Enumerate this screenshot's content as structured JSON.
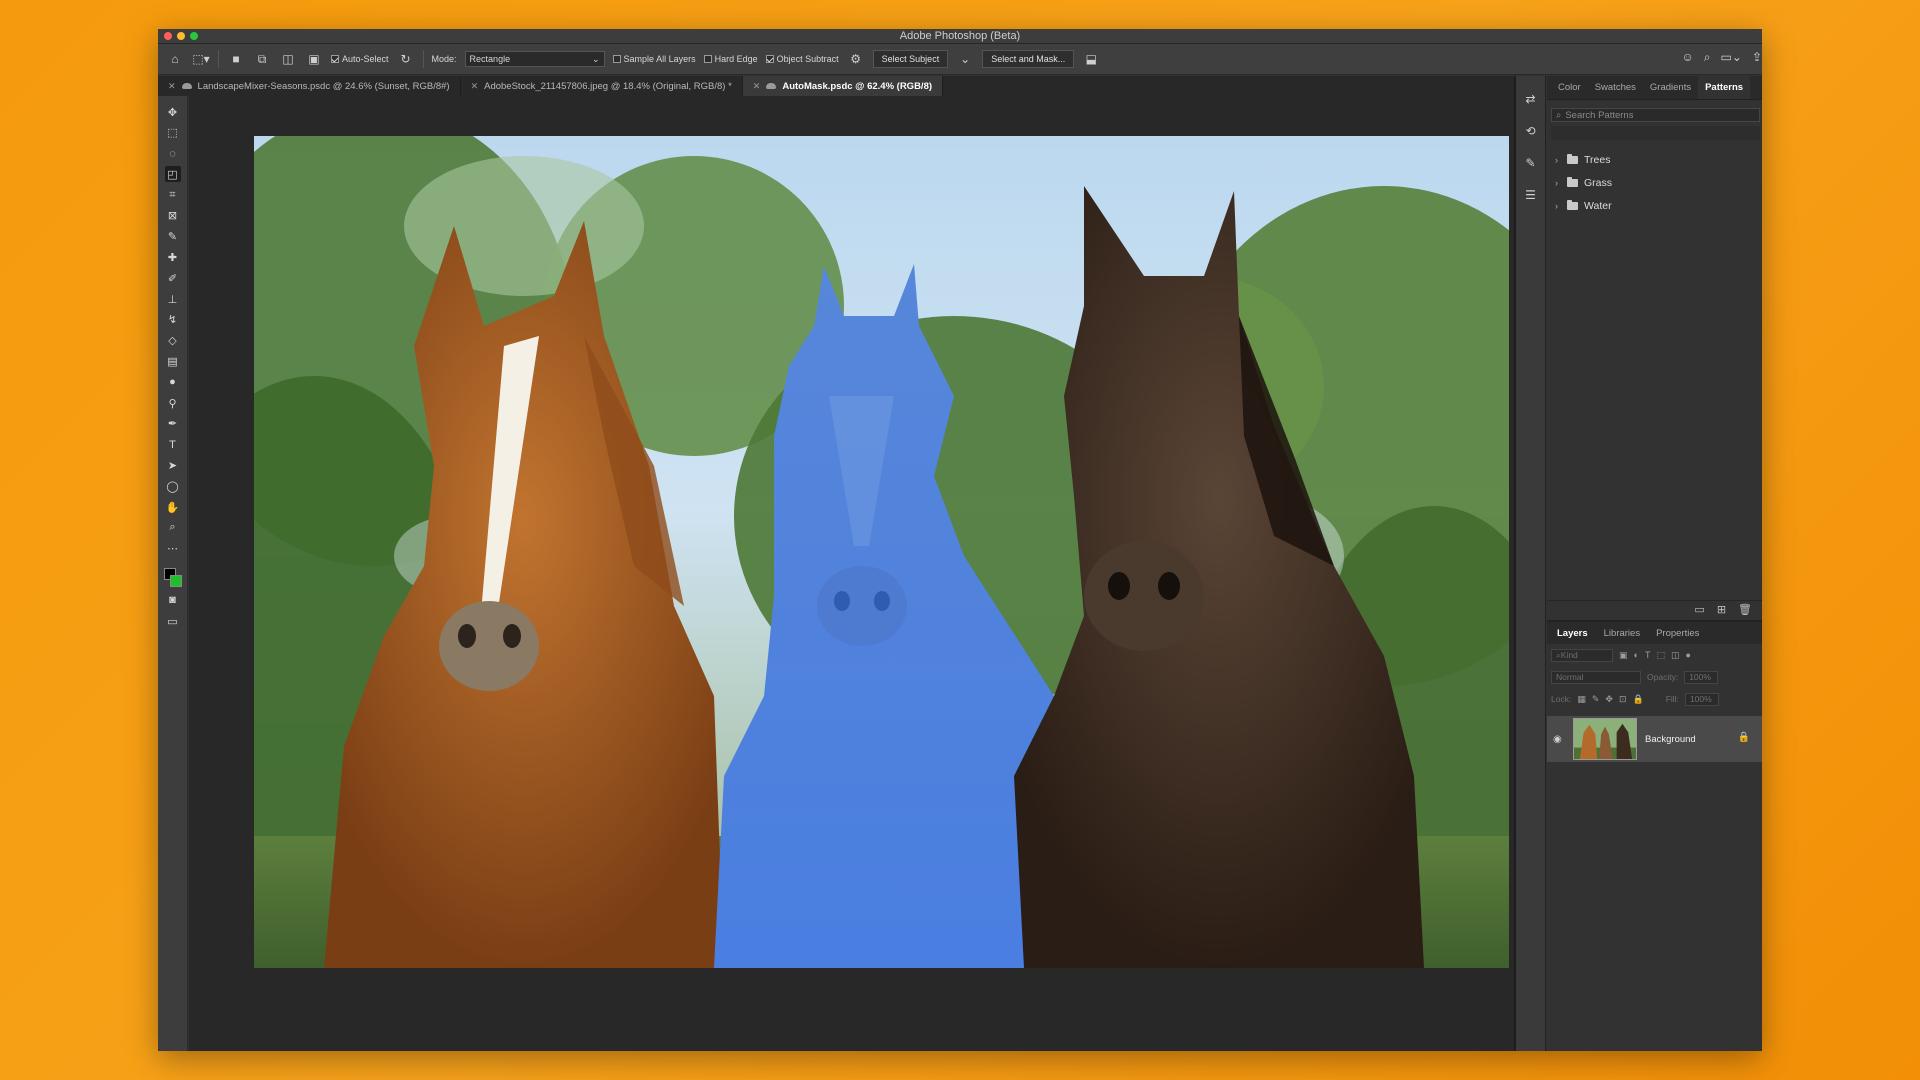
{
  "window": {
    "title": "Adobe Photoshop (Beta)"
  },
  "options": {
    "auto_select": "Auto-Select",
    "mode_label": "Mode:",
    "mode_value": "Rectangle",
    "sample_all_layers": "Sample All Layers",
    "hard_edge": "Hard Edge",
    "object_subtract": "Object Subtract",
    "select_subject": "Select Subject",
    "select_and_mask": "Select and Mask..."
  },
  "tabs": [
    {
      "label": "LandscapeMixer-Seasons.psdc @ 24.6% (Sunset, RGB/8#)"
    },
    {
      "label": "AdobeStock_211457806.jpeg @ 18.4% (Original, RGB/8) *"
    },
    {
      "label": "AutoMask.psdc @ 62.4% (RGB/8)"
    }
  ],
  "panels": {
    "top_tabs": [
      "Color",
      "Swatches",
      "Gradients",
      "Patterns"
    ],
    "search_placeholder": "Search Patterns",
    "patterns": [
      "Trees",
      "Grass",
      "Water"
    ]
  },
  "layers_panel": {
    "tabs": [
      "Layers",
      "Libraries",
      "Properties"
    ],
    "kind_label": "Kind",
    "blend_mode": "Normal",
    "opacity_label": "Opacity:",
    "opacity_value": "100%",
    "lock_label": "Lock:",
    "fill_label": "Fill:",
    "fill_value": "100%",
    "layer_name": "Background"
  },
  "colors": {
    "foreground": "#000000",
    "background": "#1fbf2a",
    "mask_overlay": "#4a7fe0"
  }
}
